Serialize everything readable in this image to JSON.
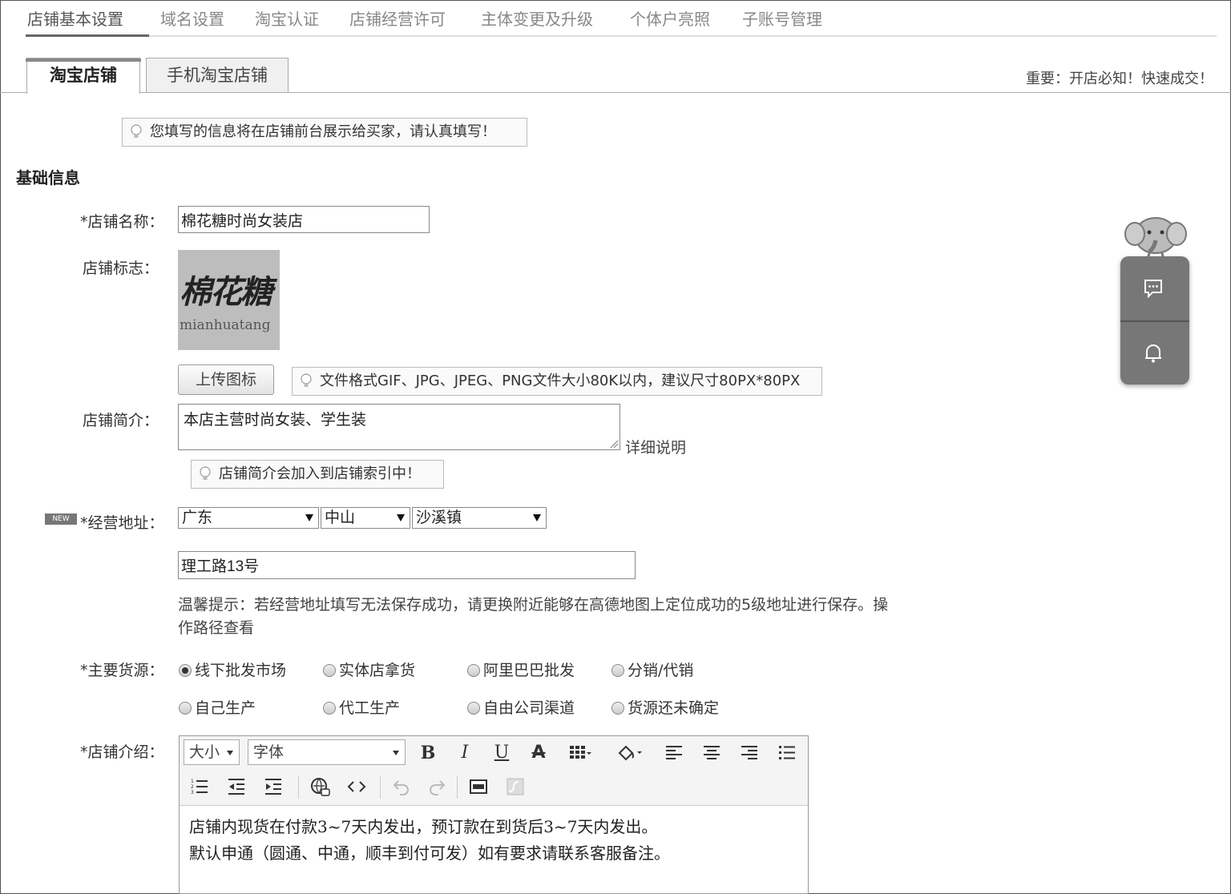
{
  "top_nav": {
    "items": [
      "店铺基本设置",
      "域名设置",
      "淘宝认证",
      "店铺经营许可",
      "主体变更及升级",
      "个体户亮照",
      "子账号管理"
    ]
  },
  "tabs": [
    "淘宝店铺",
    "手机淘宝店铺"
  ],
  "important_notice": "重要：开店必知！快速成交！",
  "top_tip": "您填写的信息将在店铺前台展示给买家，请认真填写！",
  "section_title": "基础信息",
  "form": {
    "shop_name_label": "*店铺名称：",
    "shop_name_value": "棉花糖时尚女装店",
    "logo_label": "店铺标志：",
    "logo_text_cn": "棉花糖",
    "logo_text_en": "mianhuatang",
    "upload_button": "上传图标",
    "upload_tip": "文件格式GIF、JPG、JPEG、PNG文件大小80K以内，建议尺寸80PX*80PX",
    "intro_label": "店铺简介：",
    "intro_value": "本店主营时尚女装、学生装",
    "intro_detail_link": "详细说明",
    "intro_tip": "店铺简介会加入到店铺索引中！",
    "new_badge": "NEW",
    "address_label": "*经营地址：",
    "province": "广东",
    "city": "中山",
    "town": "沙溪镇",
    "street": "理工路13号",
    "address_hint": "温馨提示：若经营地址填写无法保存成功，请更换附近能够在高德地图上定位成功的5级地址进行保存。操作路径查看",
    "source_label": "*主要货源：",
    "source_options": [
      "线下批发市场",
      "实体店拿货",
      "阿里巴巴批发",
      "分销/代销",
      "自己生产",
      "代工生产",
      "自由公司渠道",
      "货源还未确定"
    ],
    "source_selected": "线下批发市场",
    "desc_label": "*店铺介绍：",
    "editor": {
      "size_select": "大小",
      "font_select": "字体",
      "content_line1": "店铺内现货在付款3~7天内发出，预订款在到货后3~7天内发出。",
      "content_line2": "默认申通（圆通、中通，顺丰到付可发）如有要求请联系客服备注。"
    }
  },
  "widget_icons": [
    "elephant-mascot-icon",
    "chat-icon",
    "bell-icon"
  ]
}
